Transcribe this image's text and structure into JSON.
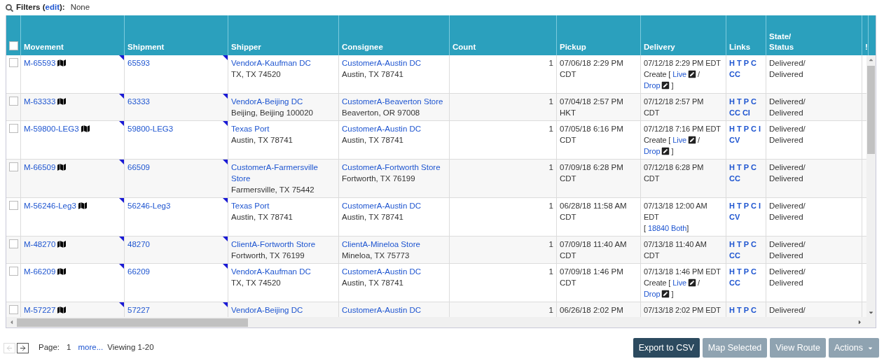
{
  "filters": {
    "label": "Filters (",
    "edit": "edit",
    "suffix": "):",
    "value": "None"
  },
  "table": {
    "select_all": {
      "checked": false
    },
    "columns": [
      "Movement",
      "Shipment",
      "Shipper",
      "Consignee",
      "Count",
      "Pickup",
      "Delivery",
      "Links",
      "State/\nStatus",
      "!"
    ],
    "rows": [
      {
        "checked": false,
        "movement": "M-65593",
        "shipment": "65593",
        "shipper": {
          "name": "VendorA-Kaufman DC",
          "address": "TX, TX 74520"
        },
        "consignee": {
          "name": "CustomerA-Austin DC",
          "address": "Austin, TX 78741"
        },
        "count": "1",
        "pickup": "07/06/18 2:29 PM\nCDT",
        "delivery": [
          {
            "kind": "text",
            "text": "07/12/18 2:29 PM EDT"
          },
          {
            "kind": "br"
          },
          {
            "kind": "text",
            "text": "Create ["
          },
          {
            "kind": "link",
            "text": "Live"
          },
          {
            "kind": "edit"
          },
          {
            "kind": "text",
            "text": "/"
          },
          {
            "kind": "br"
          },
          {
            "kind": "link",
            "text": "Drop"
          },
          {
            "kind": "edit"
          },
          {
            "kind": "text",
            "text": "]"
          }
        ],
        "links": [
          [
            "H",
            "T",
            "P",
            "C"
          ],
          [
            "CC"
          ]
        ],
        "status": "Delivered/\nDelivered"
      },
      {
        "checked": false,
        "movement": "M-63333",
        "shipment": "63333",
        "shipper": {
          "name": "VendorA-Beijing DC",
          "address": "Beijing, Beijing 100020"
        },
        "consignee": {
          "name": "CustomerA-Beaverton Store",
          "address": "Beaverton, OR 97008"
        },
        "count": "1",
        "pickup": "07/04/18 2:57 PM\nHKT",
        "delivery": [
          {
            "kind": "text",
            "text": "07/12/18 2:57 PM\nCDT"
          }
        ],
        "links": [
          [
            "H",
            "T",
            "P",
            "C"
          ],
          [
            "CC",
            "CI"
          ]
        ],
        "status": "Delivered/\nDelivered"
      },
      {
        "checked": false,
        "movement": "M-59800-LEG3",
        "shipment": "59800-LEG3",
        "shipper": {
          "name": "Texas Port",
          "address": "Austin, TX 78741"
        },
        "consignee": {
          "name": "CustomerA-Austin DC",
          "address": "Austin, TX 78741"
        },
        "count": "1",
        "pickup": "07/05/18 6:16 PM\nCDT",
        "delivery": [
          {
            "kind": "text",
            "text": "07/12/18 7:16 PM EDT"
          },
          {
            "kind": "br"
          },
          {
            "kind": "text",
            "text": "Create ["
          },
          {
            "kind": "link",
            "text": "Live"
          },
          {
            "kind": "edit"
          },
          {
            "kind": "text",
            "text": "/"
          },
          {
            "kind": "br"
          },
          {
            "kind": "link",
            "text": "Drop"
          },
          {
            "kind": "edit"
          },
          {
            "kind": "text",
            "text": "]"
          }
        ],
        "links": [
          [
            "H",
            "T",
            "P",
            "C",
            "I"
          ],
          [
            "CV"
          ]
        ],
        "status": "Delivered/\nDelivered"
      },
      {
        "checked": false,
        "movement": "M-66509",
        "shipment": "66509",
        "shipper": {
          "name": "CustomerA-Farmersville Store",
          "address": "Farmersville, TX 75442"
        },
        "consignee": {
          "name": "CustomerA-Fortworth Store",
          "address": "Fortworth, TX 76199"
        },
        "count": "1",
        "pickup": "07/09/18 6:28 PM\nCDT",
        "delivery": [
          {
            "kind": "text",
            "text": "07/12/18 6:28 PM\nCDT"
          }
        ],
        "links": [
          [
            "H",
            "T",
            "P",
            "C"
          ],
          [
            "CC"
          ]
        ],
        "status": "Delivered/\nDelivered"
      },
      {
        "checked": false,
        "movement": "M-56246-Leg3",
        "shipment": "56246-Leg3",
        "shipper": {
          "name": "Texas Port",
          "address": "Austin, TX 78741"
        },
        "consignee": {
          "name": "CustomerA-Austin DC",
          "address": "Austin, TX 78741"
        },
        "count": "1",
        "pickup": "06/28/18 11:58 AM\nCDT",
        "delivery": [
          {
            "kind": "text",
            "text": "07/13/18 12:00 AM\nEDT"
          },
          {
            "kind": "br"
          },
          {
            "kind": "text",
            "text": "["
          },
          {
            "kind": "link",
            "text": "18840 Both"
          },
          {
            "kind": "text",
            "text": "]"
          }
        ],
        "links": [
          [
            "H",
            "T",
            "P",
            "C",
            "I"
          ],
          [
            "CV"
          ]
        ],
        "status": "Delivered/\nDelivered"
      },
      {
        "checked": false,
        "movement": "M-48270",
        "shipment": "48270",
        "shipper": {
          "name": "ClientA-Fortworth Store",
          "address": "Fortworth, TX 76199"
        },
        "consignee": {
          "name": "ClientA-Mineloa Store",
          "address": "Mineloa, TX 75773"
        },
        "count": "1",
        "pickup": "07/09/18 11:40 AM\nCDT",
        "delivery": [
          {
            "kind": "text",
            "text": "07/13/18 11:40 AM\nCDT"
          }
        ],
        "links": [
          [
            "H",
            "T",
            "P",
            "C"
          ],
          [
            "CC"
          ]
        ],
        "status": "Delivered/\nDelivered"
      },
      {
        "checked": false,
        "movement": "M-66209",
        "shipment": "66209",
        "shipper": {
          "name": "VendorA-Kaufman DC",
          "address": "TX, TX 74520"
        },
        "consignee": {
          "name": "CustomerA-Austin DC",
          "address": "Austin, TX 78741"
        },
        "count": "1",
        "pickup": "07/09/18 1:46 PM\nCDT",
        "delivery": [
          {
            "kind": "text",
            "text": "07/13/18 1:46 PM EDT"
          },
          {
            "kind": "br"
          },
          {
            "kind": "text",
            "text": "Create ["
          },
          {
            "kind": "link",
            "text": "Live"
          },
          {
            "kind": "edit"
          },
          {
            "kind": "text",
            "text": "/"
          },
          {
            "kind": "br"
          },
          {
            "kind": "link",
            "text": "Drop"
          },
          {
            "kind": "edit"
          },
          {
            "kind": "text",
            "text": "]"
          }
        ],
        "links": [
          [
            "H",
            "T",
            "P",
            "C"
          ],
          [
            "CC"
          ]
        ],
        "status": "Delivered/\nDelivered"
      },
      {
        "checked": false,
        "movement": "M-57227",
        "shipment": "57227",
        "shipper": {
          "name": "VendorA-Beijing DC"
        },
        "consignee": {
          "name": "CustomerA-Austin DC"
        },
        "count": "1",
        "pickup": "06/26/18 2:02 PM",
        "delivery": [
          {
            "kind": "text",
            "text": "07/13/18 2:02 PM EDT"
          }
        ],
        "links": [
          [
            "H",
            "T",
            "P",
            "C"
          ]
        ],
        "status": "Delivered/"
      }
    ]
  },
  "pager": {
    "prev_disabled": true,
    "page_label": "Page:",
    "page": "1",
    "more": "more...",
    "viewing": "Viewing 1-20"
  },
  "buttons": [
    {
      "label": "Export to CSV",
      "kind": "primary"
    },
    {
      "label": "Map Selected",
      "kind": "secondary"
    },
    {
      "label": "View Route",
      "kind": "secondary"
    },
    {
      "label": "Actions",
      "kind": "menu"
    }
  ]
}
